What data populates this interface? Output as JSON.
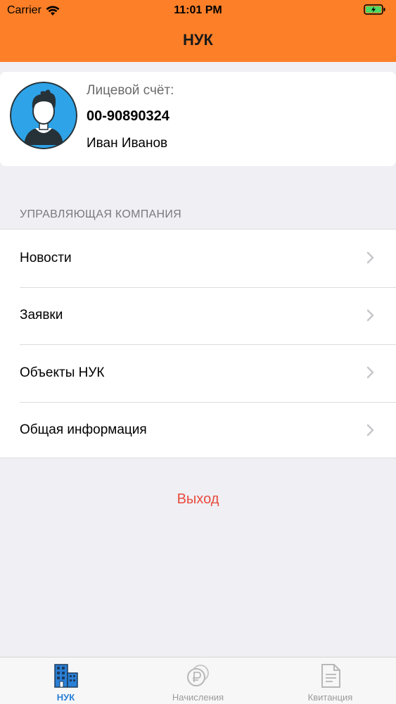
{
  "status_bar": {
    "carrier": "Carrier",
    "time": "11:01 PM"
  },
  "header": {
    "title": "НУК"
  },
  "profile": {
    "account_label": "Лицевой счёт:",
    "account_number": "00-90890324",
    "name": "Иван Иванов"
  },
  "section": {
    "header": "УПРАВЛЯЮЩАЯ КОМПАНИЯ",
    "items": [
      {
        "label": "Новости"
      },
      {
        "label": "Заявки"
      },
      {
        "label": "Объекты НУК"
      },
      {
        "label": "Общая информация"
      }
    ]
  },
  "logout": {
    "label": "Выход"
  },
  "tabbar": {
    "tabs": [
      {
        "label": "НУК",
        "icon": "building-icon",
        "active": true
      },
      {
        "label": "Начисления",
        "icon": "ruble-coin-icon",
        "active": false
      },
      {
        "label": "Квитанция",
        "icon": "document-icon",
        "active": false
      }
    ]
  },
  "colors": {
    "header": "#fd7f28",
    "accent": "#2a7fd6",
    "logout": "#e94b3c",
    "background": "#efeff4"
  }
}
